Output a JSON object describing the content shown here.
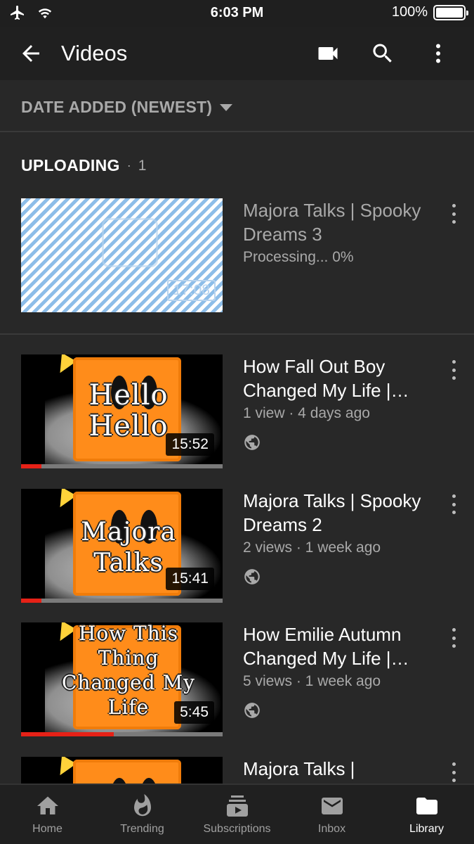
{
  "status_bar": {
    "time": "6:03 PM",
    "battery": "100%"
  },
  "app_bar": {
    "title": "Videos"
  },
  "sort": {
    "label": "DATE ADDED (NEWEST)"
  },
  "uploading": {
    "header": "UPLOADING",
    "separator": "·",
    "count": "1",
    "item": {
      "title": "Majora Talks | Spooky Dreams 3",
      "status": "Processing... 0%",
      "ghost_duration": "17:08"
    }
  },
  "videos": [
    {
      "title": "How Fall Out Boy Changed My Life | Spooky Dreams",
      "stats": "1 view · 4 days ago",
      "duration": "15:52",
      "overlay": "Hello Hello",
      "progress": 0.1
    },
    {
      "title": "Majora Talks | Spooky Dreams 2",
      "stats": "2 views · 1 week ago",
      "duration": "15:41",
      "overlay": "Majora Talks",
      "progress": 0.1
    },
    {
      "title": "How Emilie Autumn Changed My Life | Spooky Dreams",
      "stats": "5 views · 1 week ago",
      "duration": "5:45",
      "overlay": "How This Thing Changed My Life",
      "progress": 0.46
    },
    {
      "title": "Majora Talks |"
    }
  ],
  "bottom_nav": [
    {
      "label": "Home",
      "icon": "home-icon"
    },
    {
      "label": "Trending",
      "icon": "flame-icon"
    },
    {
      "label": "Subscriptions",
      "icon": "subscriptions-icon"
    },
    {
      "label": "Inbox",
      "icon": "inbox-icon"
    },
    {
      "label": "Library",
      "icon": "library-folder-icon",
      "active": true
    }
  ],
  "colors": {
    "background": "#282828",
    "bar": "#202020",
    "accent_progress": "#e62117",
    "thumb_orange": "#ff8c1a"
  }
}
